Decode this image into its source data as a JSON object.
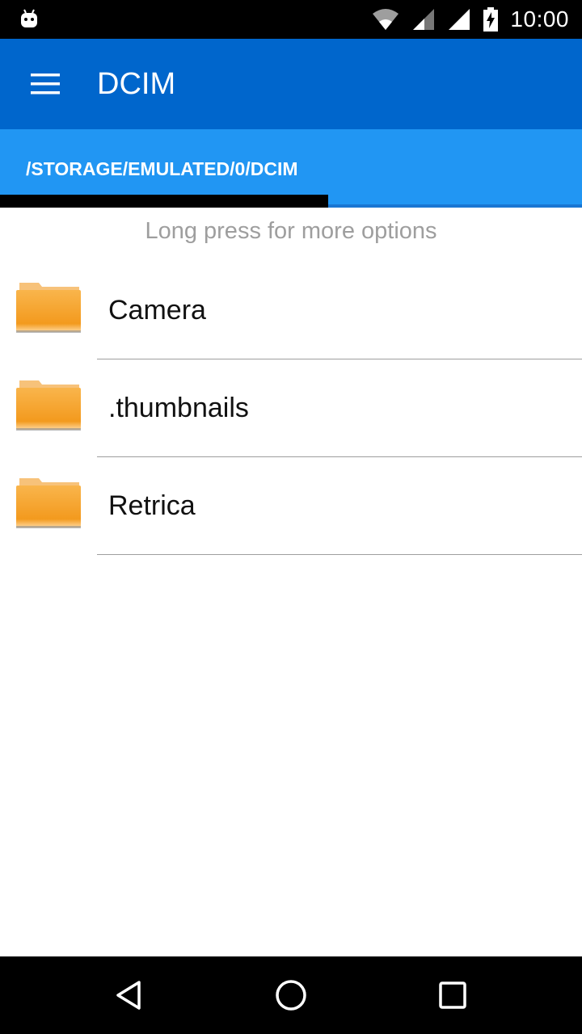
{
  "status_bar": {
    "time": "10:00",
    "icons": [
      "android-icon",
      "wifi-icon",
      "signal-icon",
      "signal-full-icon",
      "battery-charging-icon"
    ]
  },
  "app_bar": {
    "title": "DCIM",
    "menu_icon": "hamburger-menu-icon"
  },
  "path_bar": {
    "path": "/STORAGE/EMULATED/0/DCIM"
  },
  "hint": "Long press for more options",
  "folders": [
    {
      "name": "Camera",
      "icon": "folder-icon"
    },
    {
      "name": ".thumbnails",
      "icon": "folder-icon"
    },
    {
      "name": "Retrica",
      "icon": "folder-icon"
    }
  ],
  "nav_bar": {
    "buttons": [
      "back-icon",
      "home-icon",
      "recents-icon"
    ]
  },
  "colors": {
    "app_bar": "#0066cc",
    "path_bar": "#2196f3",
    "folder": "#f6a623"
  }
}
